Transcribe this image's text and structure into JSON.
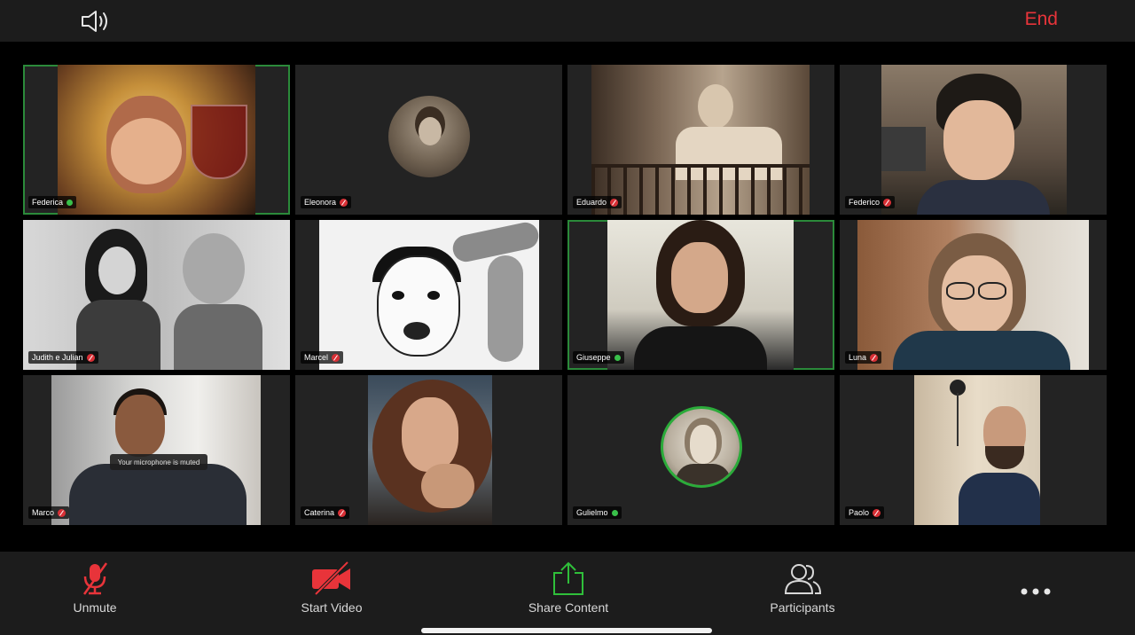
{
  "top_bar": {
    "speaker_icon": "speaker-icon",
    "end_label": "End",
    "end_color": "#e8343a"
  },
  "participants": [
    {
      "name": "Federica",
      "mic": "on",
      "active": true
    },
    {
      "name": "Eleonora",
      "mic": "muted",
      "active": false
    },
    {
      "name": "Eduardo",
      "mic": "muted",
      "active": false
    },
    {
      "name": "Federico",
      "mic": "muted",
      "active": false
    },
    {
      "name": "Judith e Julian",
      "mic": "muted",
      "active": false
    },
    {
      "name": "Marcel",
      "mic": "muted",
      "active": false
    },
    {
      "name": "Giuseppe",
      "mic": "on",
      "active": true
    },
    {
      "name": "Luna",
      "mic": "muted",
      "active": false
    },
    {
      "name": "Marco",
      "mic": "muted",
      "active": false,
      "toast": "Your microphone is muted"
    },
    {
      "name": "Caterina",
      "mic": "muted",
      "active": false
    },
    {
      "name": "Gulielmo",
      "mic": "on",
      "active": false
    },
    {
      "name": "Paolo",
      "mic": "muted",
      "active": false
    }
  ],
  "bottom_bar": {
    "unmute_label": "Unmute",
    "start_video_label": "Start Video",
    "share_content_label": "Share Content",
    "participants_label": "Participants",
    "more_icon": "more-dots-icon",
    "muted_color": "#e8343a",
    "share_color": "#2fbf3a"
  }
}
